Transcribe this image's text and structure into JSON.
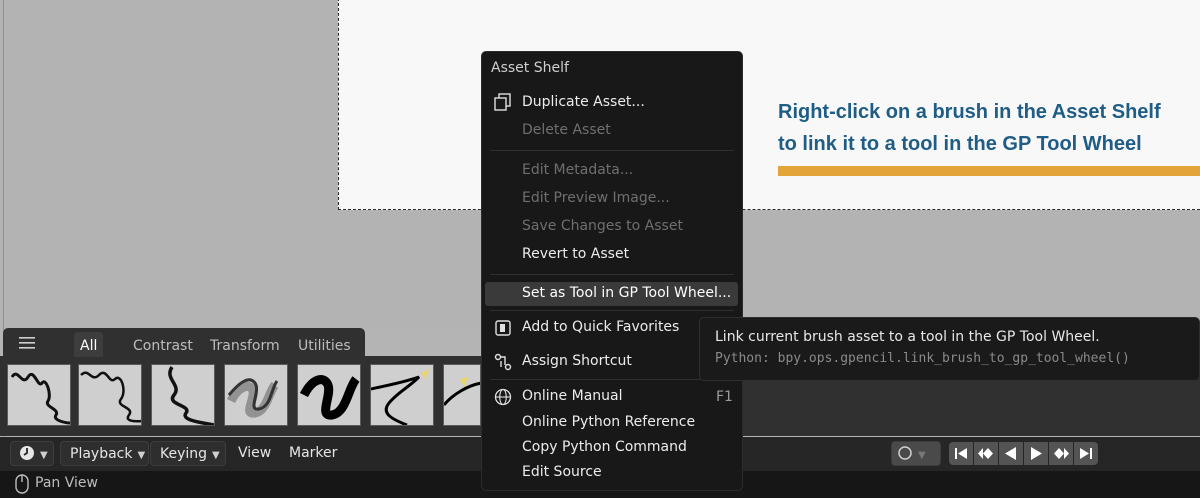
{
  "annotation": {
    "line1": "Right-click on a brush in the Asset Shelf",
    "line2": "to link it to a tool in the GP Tool Wheel",
    "text_color": "#1f5d86",
    "underline_color": "#e3a43a"
  },
  "asset_shelf": {
    "tabs": [
      "All",
      "Contrast",
      "Transform",
      "Utilities"
    ],
    "active_tab": "All",
    "menu_icon": "hamburger-icon"
  },
  "context_menu": {
    "title": "Asset Shelf",
    "items": [
      {
        "label": "Duplicate Asset...",
        "enabled": true,
        "icon": "duplicate-icon"
      },
      {
        "label": "Delete Asset",
        "enabled": false
      },
      {
        "label": "Edit Metadata...",
        "enabled": false
      },
      {
        "label": "Edit Preview Image...",
        "enabled": false
      },
      {
        "label": "Save Changes to Asset",
        "enabled": false
      },
      {
        "label": "Revert to Asset",
        "enabled": true
      },
      {
        "label": "Set as Tool in GP Tool Wheel...",
        "enabled": true,
        "highlighted": true
      },
      {
        "label": "Add to Quick Favorites",
        "enabled": true,
        "icon": "quick-favorites-icon"
      },
      {
        "label": "Assign Shortcut",
        "enabled": true,
        "icon": "shortcut-icon"
      },
      {
        "label": "Online Manual",
        "enabled": true,
        "icon": "globe-icon",
        "shortcut": "F1"
      },
      {
        "label": "Online Python Reference",
        "enabled": true
      },
      {
        "label": "Copy Python Command",
        "enabled": true
      },
      {
        "label": "Edit Source",
        "enabled": true
      }
    ]
  },
  "tooltip": {
    "description": "Link current brush asset to a tool in the GP Tool Wheel.",
    "python": "Python: bpy.ops.gpencil.link_brush_to_gp_tool_wheel()"
  },
  "timeline_header": {
    "editor_icon": "clock-icon",
    "playback_label": "Playback",
    "keying_label": "Keying",
    "view_label": "View",
    "marker_label": "Marker",
    "record_icon": "record-icon",
    "playback_icons": [
      "jump-start-icon",
      "prev-keyframe-icon",
      "play-reverse-icon",
      "play-icon",
      "next-keyframe-icon",
      "jump-end-icon"
    ]
  },
  "status_bar": {
    "mouse_icon": "mouse-icon",
    "text": "Pan View"
  }
}
